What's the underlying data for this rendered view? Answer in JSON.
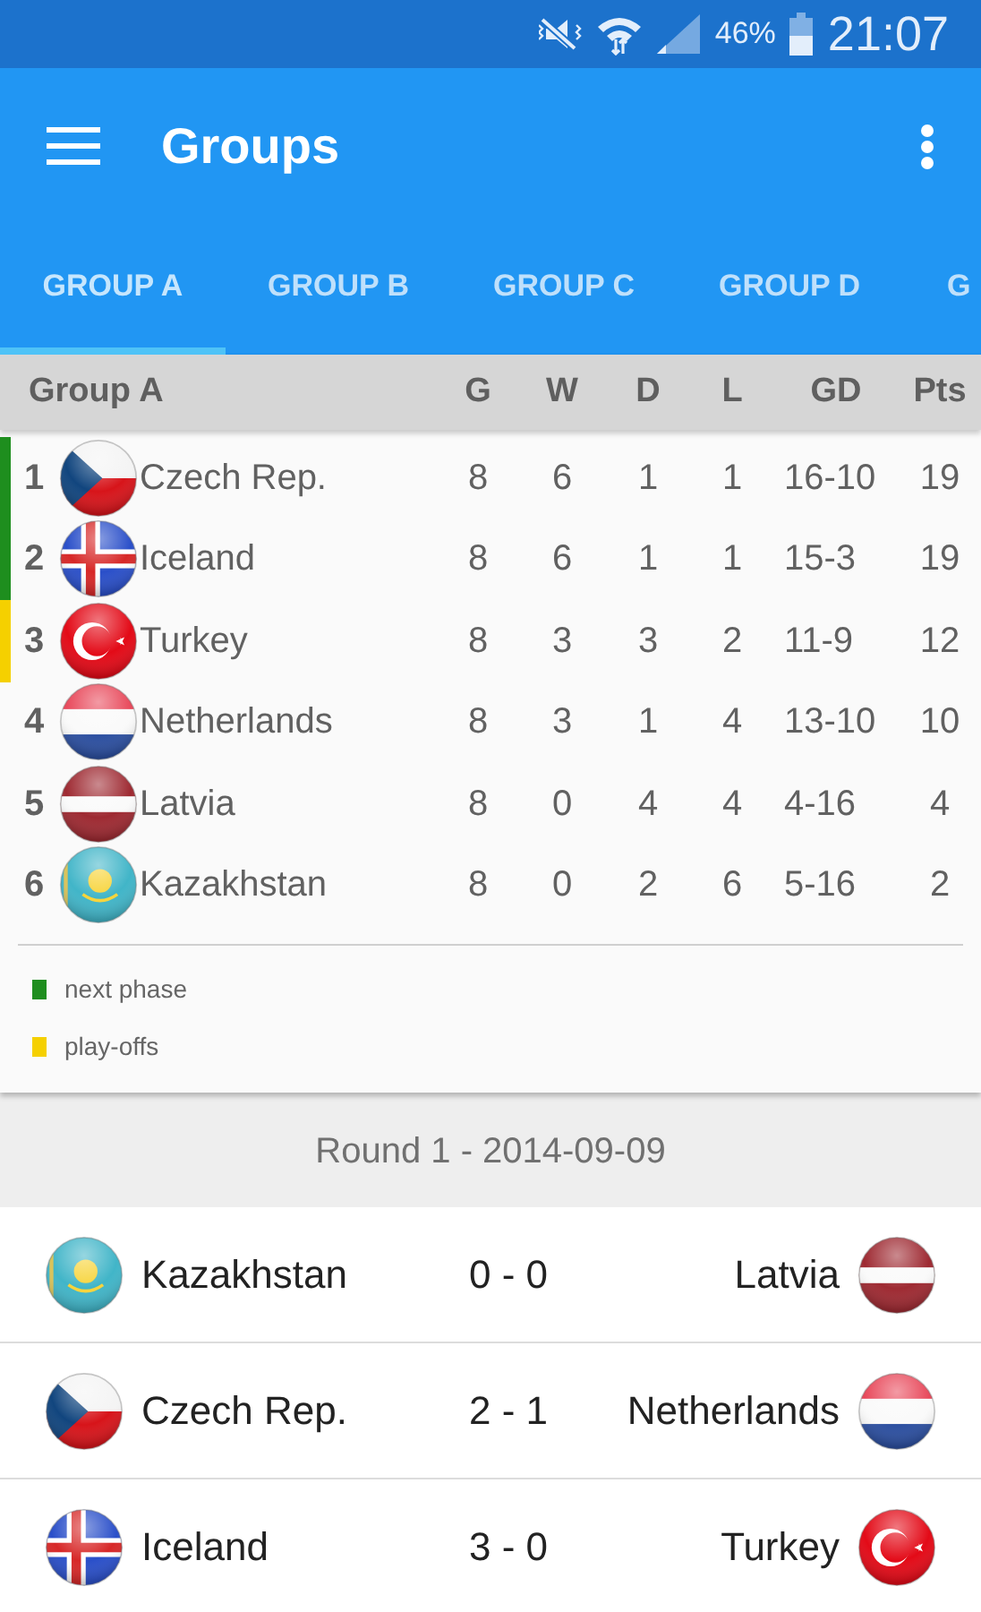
{
  "status_bar": {
    "battery": "46%",
    "time": "21:07"
  },
  "app_bar": {
    "title": "Groups"
  },
  "tabs": [
    {
      "label": "GROUP A",
      "selected": true
    },
    {
      "label": "GROUP B",
      "selected": false
    },
    {
      "label": "GROUP C",
      "selected": false
    },
    {
      "label": "GROUP D",
      "selected": false
    },
    {
      "label": "G",
      "selected": false
    }
  ],
  "table": {
    "columns": [
      "Group A",
      "",
      "G",
      "W",
      "D",
      "L",
      "GD",
      "Pts"
    ],
    "rows": [
      {
        "kind": "czech",
        "cells": [
          "1",
          "Czech Rep.",
          "8",
          "6",
          "1",
          "1",
          "16-10",
          "19"
        ],
        "color": "#1e8e1e"
      },
      {
        "kind": "iceland",
        "cells": [
          "2",
          "Iceland",
          "8",
          "6",
          "1",
          "1",
          "15-3",
          "19"
        ],
        "color": "#1e8e1e"
      },
      {
        "kind": "turkey",
        "cells": [
          "3",
          "Turkey",
          "8",
          "3",
          "3",
          "2",
          "11-9",
          "12"
        ],
        "color": "#f5d000"
      },
      {
        "kind": "netherlands",
        "cells": [
          "4",
          "Netherlands",
          "8",
          "3",
          "1",
          "4",
          "13-10",
          "10"
        ]
      },
      {
        "kind": "latvia",
        "cells": [
          "5",
          "Latvia",
          "8",
          "0",
          "4",
          "4",
          "4-16",
          "4"
        ]
      },
      {
        "kind": "kazakhstan",
        "cells": [
          "6",
          "Kazakhstan",
          "8",
          "0",
          "2",
          "6",
          "5-16",
          "2"
        ]
      }
    ],
    "legend": [
      {
        "label": "next phase",
        "color": "#1e8e1e"
      },
      {
        "label": "play-offs",
        "color": "#f5d000"
      }
    ]
  },
  "round": {
    "title": "Round 1 - 2014-09-09",
    "matches": [
      {
        "home": {
          "team": "Kazakhstan",
          "kind": "kazakhstan"
        },
        "score": "0 - 0",
        "away": {
          "team": "Latvia",
          "kind": "latvia"
        }
      },
      {
        "home": {
          "team": "Czech Rep.",
          "kind": "czech"
        },
        "score": "2 - 1",
        "away": {
          "team": "Netherlands",
          "kind": "netherlands"
        }
      },
      {
        "home": {
          "team": "Iceland",
          "kind": "iceland"
        },
        "score": "3 - 0",
        "away": {
          "team": "Turkey",
          "kind": "turkey"
        }
      }
    ]
  }
}
